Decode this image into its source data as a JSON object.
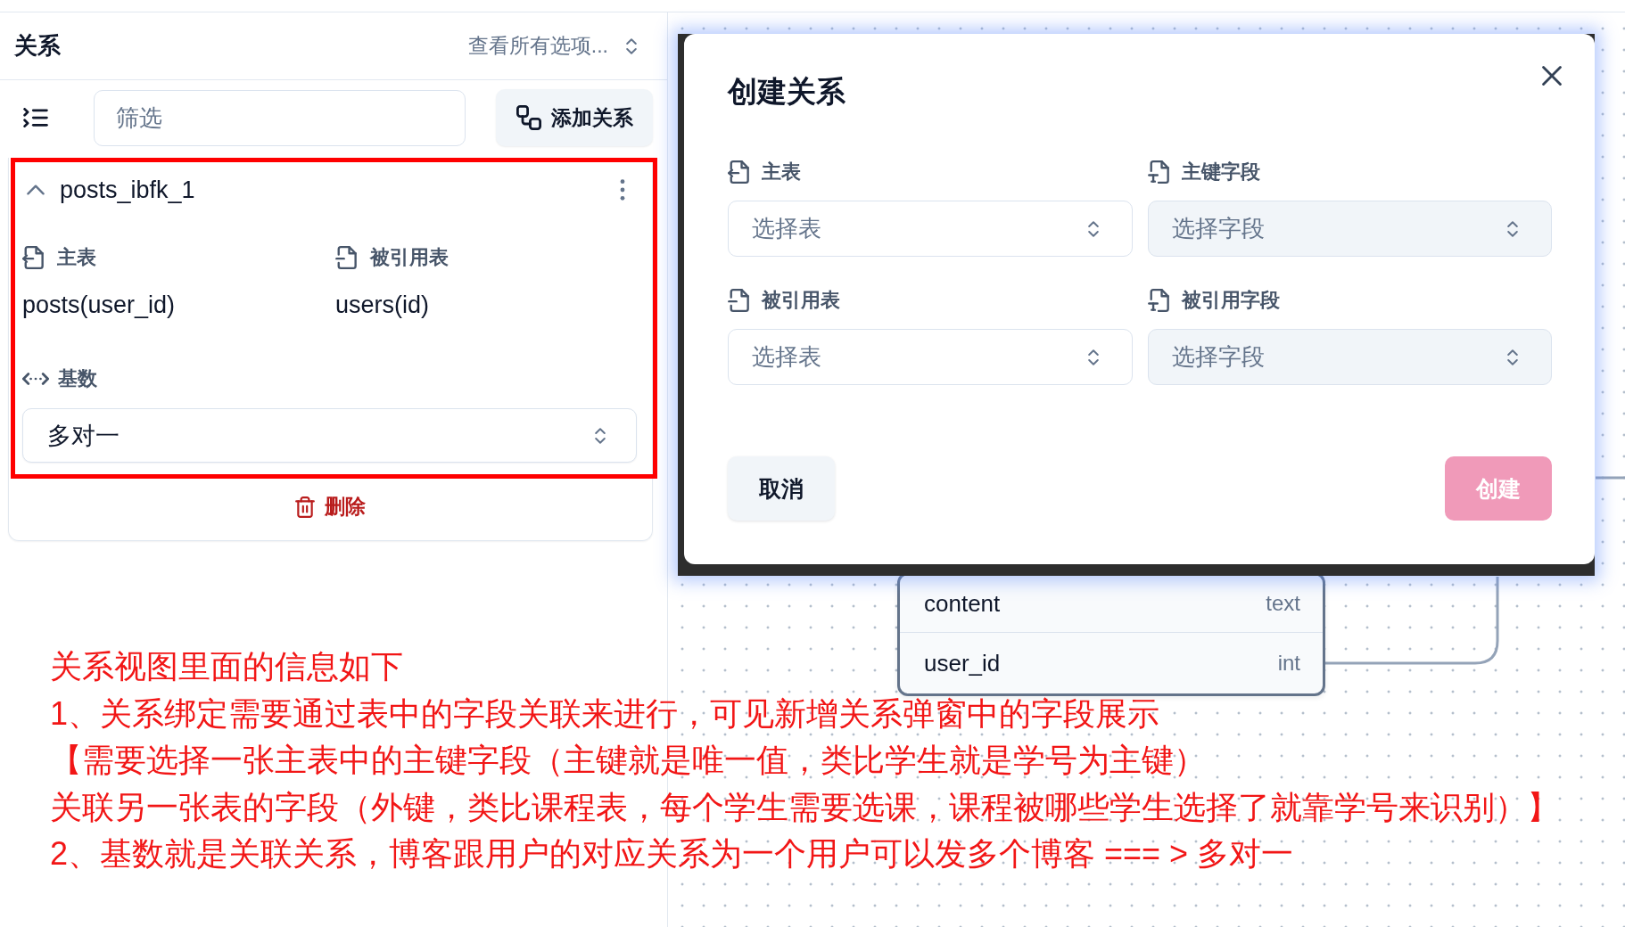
{
  "relations_panel": {
    "title": "关系",
    "view_select": {
      "value": "查看所有选项..."
    },
    "filter": {
      "placeholder": "筛选"
    },
    "add_button": "添加关系",
    "relations": [
      {
        "name": "posts_ibfk_1",
        "expanded": true,
        "highlighted": true,
        "fields": [
          {
            "kind": "primary_table",
            "label": "主表",
            "value": "posts(user_id)"
          },
          {
            "kind": "referenced_table",
            "label": "被引用表",
            "value": "users(id)"
          }
        ],
        "cardinality": {
          "label": "基数",
          "value": "多对一"
        },
        "delete_button": "删除"
      }
    ]
  },
  "canvas": {
    "table_node": {
      "rows": [
        {
          "name": "content",
          "type": "text"
        },
        {
          "name": "user_id",
          "type": "int"
        }
      ]
    }
  },
  "dialog": {
    "title": "创建关系",
    "fields": [
      {
        "kind": "primary_table",
        "label": "主表",
        "placeholder": "选择表",
        "disabled": false
      },
      {
        "kind": "primary_field",
        "label": "主键字段",
        "placeholder": "选择字段",
        "disabled": true
      },
      {
        "kind": "referenced_table",
        "label": "被引用表",
        "placeholder": "选择表",
        "disabled": false
      },
      {
        "kind": "referenced_field",
        "label": "被引用字段",
        "placeholder": "选择字段",
        "disabled": true
      }
    ],
    "buttons": [
      {
        "kind": "cancel",
        "label": "取消",
        "disabled": false
      },
      {
        "kind": "create",
        "label": "创建",
        "disabled": true
      }
    ]
  },
  "annotation": {
    "lines": [
      "关系视图里面的信息如下",
      "1、关系绑定需要通过表中的字段关联来进行，可见新增关系弹窗中的字段展示",
      "【需要选择一张主表中的主键字段（主键就是唯一值，类比学生就是学号为主键）",
      "关联另一张表的字段（外键，类比课程表，每个学生需要选课，课程被哪些学生选择了就靠学号来识别）】",
      "2、基数就是关联关系，博客跟用户的对应关系为一个用户可以发多个博客 === > 多对一"
    ]
  }
}
